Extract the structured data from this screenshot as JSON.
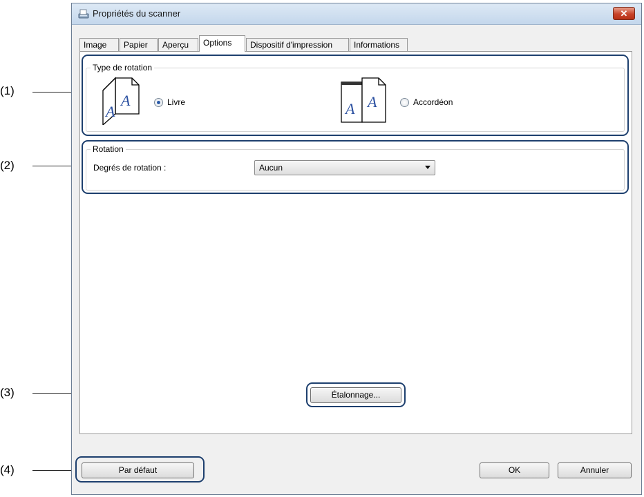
{
  "callouts": [
    "(1)",
    "(2)",
    "(3)",
    "(4)"
  ],
  "window": {
    "title": "Propriétés du scanner",
    "icon": "scanner-icon",
    "close_label": "✕"
  },
  "tabs": [
    {
      "label": "Image"
    },
    {
      "label": "Papier"
    },
    {
      "label": "Aperçu"
    },
    {
      "label": "Options",
      "active": true
    },
    {
      "label": "Dispositif d'impression"
    },
    {
      "label": "Informations"
    }
  ],
  "rotation_type": {
    "group_title": "Type de rotation",
    "option_book": "Livre",
    "option_fanfold": "Accordéon",
    "selected": "Livre",
    "page_glyph": "A"
  },
  "rotation": {
    "group_title": "Rotation",
    "degrees_label": "Degrés de rotation :",
    "degrees_value": "Aucun"
  },
  "buttons": {
    "calibration": "Étalonnage...",
    "default": "Par défaut",
    "ok": "OK",
    "cancel": "Annuler"
  },
  "colors": {
    "highlight": "#1d3f6e",
    "close_button": "#c7432a"
  }
}
